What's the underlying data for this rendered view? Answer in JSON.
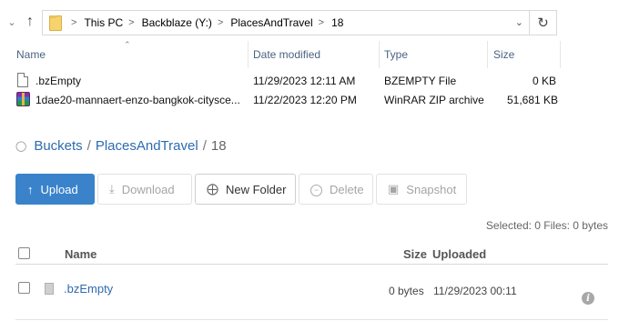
{
  "explorer": {
    "path": [
      "This PC",
      "Backblaze (Y:)",
      "PlacesAndTravel",
      "18"
    ],
    "columns": {
      "name": "Name",
      "date": "Date modified",
      "type": "Type",
      "size": "Size"
    },
    "files": [
      {
        "name": ".bzEmpty",
        "date": "11/29/2023 12:11 AM",
        "type": "BZEMPTY File",
        "size": "0 KB",
        "icon": "document-icon"
      },
      {
        "name": "1dae20-mannaert-enzo-bangkok-citysce...",
        "date": "11/22/2023 12:20 PM",
        "type": "WinRAR ZIP archive",
        "size": "51,681 KB",
        "icon": "winrar-archive-icon"
      }
    ]
  },
  "web": {
    "breadcrumb": {
      "root": "Buckets",
      "sep1": "/",
      "bucket": "PlacesAndTravel",
      "sep2": "/",
      "current": "18"
    },
    "toolbar": {
      "upload": "Upload",
      "download": "Download",
      "new_folder": "New Folder",
      "delete": "Delete",
      "snapshot": "Snapshot"
    },
    "selected_info": "Selected: 0 Files: 0 bytes",
    "table": {
      "headers": {
        "name": "Name",
        "size": "Size",
        "uploaded": "Uploaded"
      },
      "rows": [
        {
          "name": ".bzEmpty",
          "size": "0 bytes",
          "uploaded": "11/29/2023 00:11"
        }
      ]
    }
  },
  "colors": {
    "accent": "#3a83cb",
    "link": "#2d6bb0",
    "header_text": "#4a6381"
  }
}
